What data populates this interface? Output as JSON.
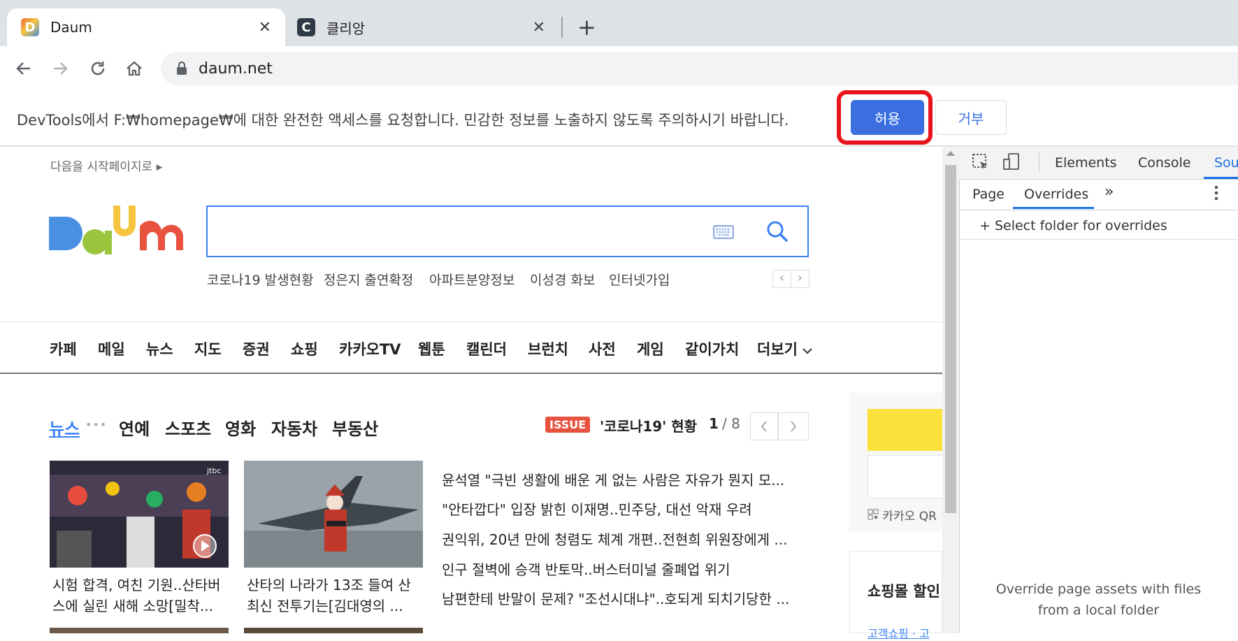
{
  "browser": {
    "tabs": [
      {
        "title": "Daum",
        "favicon": "D",
        "close": "✕"
      },
      {
        "title": "클리앙",
        "favicon": "C",
        "close": "✕"
      }
    ],
    "new_tab": "+",
    "url": "daum.net"
  },
  "permission_bar": {
    "message": "DevTools에서 F:₩homepage₩에 대한 완전한 액세스를 요청합니다. 민감한 정보를 노출하지 않도록 주의하시기 바랍니다.",
    "allow_label": "허용",
    "deny_label": "거부"
  },
  "page": {
    "set_homepage": "다음을 시작페이지로 ▸",
    "logo": "Daum",
    "trends": [
      "코로나19 발생현황",
      "정은지 출연확정",
      "아파트분양정보",
      "이성경 화보",
      "인터넷가입"
    ],
    "trend_prev": "‹",
    "trend_next": "›",
    "nav": [
      "카페",
      "메일",
      "뉴스",
      "지도",
      "증권",
      "쇼핑",
      "카카오TV",
      "웹툰",
      "캘린더",
      "브런치",
      "사전",
      "게임",
      "같이가치",
      "더보기"
    ],
    "news_tabs": {
      "active": "뉴스",
      "dots": "•••",
      "others": [
        "연예",
        "스포츠",
        "영화",
        "자동차",
        "부동산"
      ]
    },
    "issue_badge": "ISSUE",
    "issue_title": "'코로나19' 현황",
    "issue_page": "1",
    "issue_total": "/ 8",
    "thumbs": [
      {
        "line1": "시험 합격, 여친 기원..산타버",
        "line2": "스에 실린 새해 소망[밀착..."
      },
      {
        "line1": "산타의 나라가 13조 들여 산",
        "line2": "최신 전투기는[김대영의 ..."
      }
    ],
    "headlines": [
      "윤석열 \"극빈 생활에 배운 게 없는 사람은 자유가 뭔지 모...",
      "\"안타깝다\" 입장 밝힌 이재명..민주당, 대선 악재 우려",
      "권익위, 20년 만에 청렴도 체계 개편..전현희 위원장에게 ...",
      "인구 절벽에 승객 반토막..버스터미널 줄폐업 위기",
      "남편한테 반말이 문제? \"조선시대냐\"..호되게 되치기당한 ..."
    ],
    "qr_label": "카카오 QR",
    "shopping_label": "쇼핑몰 할인",
    "shopping_sub": "고객쇼핑 · 고"
  },
  "devtools": {
    "tabs": [
      "Elements",
      "Console",
      "Sou"
    ],
    "subtabs": [
      "Page",
      "Overrides"
    ],
    "more": "»",
    "select_folder": "+ Select folder for overrides",
    "empty_line1": "Override page assets with files",
    "empty_line2": "from a local folder"
  }
}
